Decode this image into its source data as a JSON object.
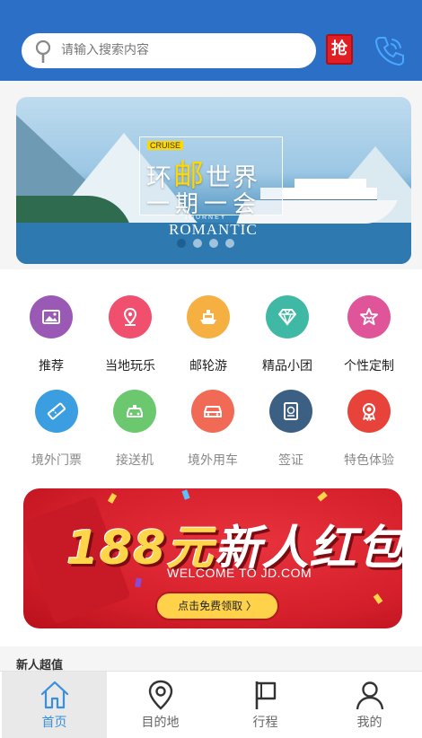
{
  "search": {
    "placeholder": "请输入搜索内容",
    "badge_char": "抢"
  },
  "banner": {
    "tag": "CRUISE",
    "title_pre": "环",
    "title_hl": "邮",
    "title_post": "世界",
    "subtitle": "一期一会",
    "journey": "JOURNEY",
    "romantic": "ROMANTIC",
    "dot_count": 4,
    "active_dot": 0
  },
  "categories": {
    "row1": [
      {
        "label": "推荐",
        "icon": "image-icon",
        "color": "#9b59b6"
      },
      {
        "label": "当地玩乐",
        "icon": "location-pin-icon",
        "color": "#f0506e"
      },
      {
        "label": "邮轮游",
        "icon": "cruise-ship-icon",
        "color": "#f5b041"
      },
      {
        "label": "精品小团",
        "icon": "diamond-icon",
        "color": "#3fb8a6"
      },
      {
        "label": "个性定制",
        "icon": "star-icon",
        "color": "#e0559a"
      }
    ],
    "row2": [
      {
        "label": "境外门票",
        "icon": "ticket-icon",
        "color": "#3a9ee0"
      },
      {
        "label": "接送机",
        "icon": "taxi-icon",
        "color": "#6cc86e"
      },
      {
        "label": "境外用车",
        "icon": "car-icon",
        "color": "#f06a56"
      },
      {
        "label": "签证",
        "icon": "passport-icon",
        "color": "#3c5f84"
      },
      {
        "label": "特色体验",
        "icon": "ribbon-icon",
        "color": "#e8433a"
      }
    ]
  },
  "promo": {
    "amount": "188元",
    "headline": "新人红包!",
    "welcome": "WELCOME TO JD.COM",
    "button": "点击免费领取 〉"
  },
  "section": {
    "new_user_title": "新人超值"
  },
  "tabs": [
    {
      "label": "首页",
      "icon": "home-icon",
      "active": true
    },
    {
      "label": "目的地",
      "icon": "location-pin-icon",
      "active": false
    },
    {
      "label": "行程",
      "icon": "flag-icon",
      "active": false
    },
    {
      "label": "我的",
      "icon": "user-icon",
      "active": false
    }
  ],
  "colors": {
    "header": "#2b6fc6",
    "active_tab": "#3a8fdc",
    "promo_red": "#d5202c"
  }
}
